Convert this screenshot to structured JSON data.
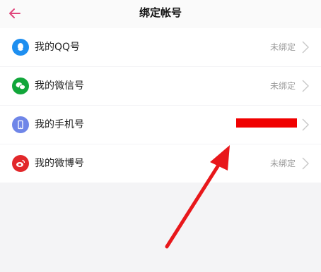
{
  "header": {
    "title": "绑定帐号",
    "back_icon": "back-arrow-icon"
  },
  "colors": {
    "accent": "#e0467c",
    "qq": "#1e8ff0",
    "wechat": "#11a63a",
    "phone": "#6f86e8",
    "weibo": "#e2282b",
    "annotation": "#e8171b"
  },
  "accounts": [
    {
      "label": "我的QQ号",
      "status": "未绑定",
      "icon": "qq-icon"
    },
    {
      "label": "我的微信号",
      "status": "未绑定",
      "icon": "wechat-icon"
    },
    {
      "label": "我的手机号",
      "status": "",
      "icon": "phone-icon"
    },
    {
      "label": "我的微博号",
      "status": "未绑定",
      "icon": "weibo-icon"
    }
  ]
}
